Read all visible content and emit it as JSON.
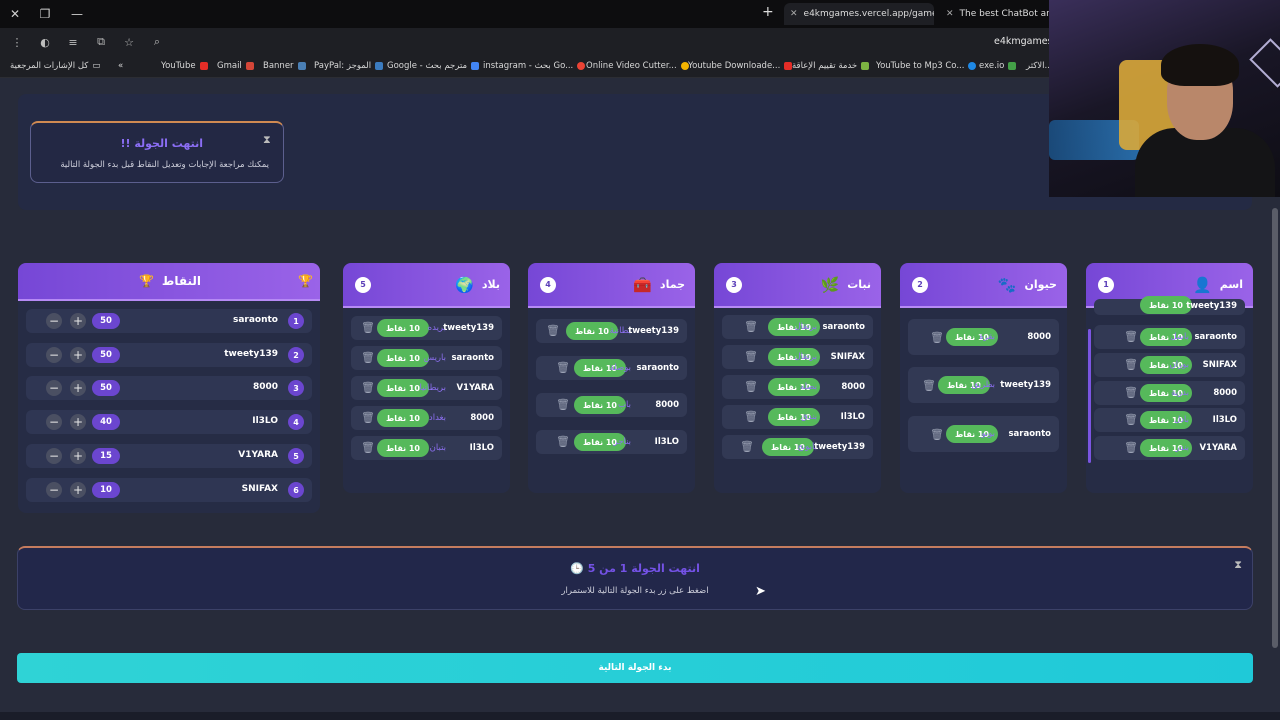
{
  "browser": {
    "tabs": [
      {
        "label": "e4kmgames.vercel.app/games/"
      },
      {
        "label": "The best ChatBot and Wi"
      }
    ],
    "url": "e4kmgames.v",
    "bookmarks": [
      {
        "label": "كل الإشارات المرجعية"
      },
      {
        "label": "YouTube"
      },
      {
        "label": "Gmail"
      },
      {
        "label": "Banner"
      },
      {
        "label": "PayPal: الموجز"
      },
      {
        "label": "Google - مترجم بحث"
      },
      {
        "label": "instagram - بحث Go..."
      },
      {
        "label": "Online Video Cutter..."
      },
      {
        "label": "Youtube Downloade..."
      },
      {
        "label": "خدمة تقييم الإعاقة"
      },
      {
        "label": "YouTube to Mp3 Co..."
      },
      {
        "label": "exe.io"
      },
      {
        "label": "الاكثر..."
      }
    ]
  },
  "notice": {
    "title": "انتهت الجولة !!",
    "subtitle": "يمكنك مراجعة الإجابات وتعديل النقاط قبل بدء الجولة التالية"
  },
  "scoreboard": {
    "title": "النقاط",
    "rows": [
      {
        "rank": "1",
        "name": "saraonto",
        "score": "50"
      },
      {
        "rank": "2",
        "name": "tweety139",
        "score": "50"
      },
      {
        "rank": "3",
        "name": "8000",
        "score": "50"
      },
      {
        "rank": "4",
        "name": "Il3LO",
        "score": "40"
      },
      {
        "rank": "5",
        "name": "V1YARA",
        "score": "15"
      },
      {
        "rank": "6",
        "name": "SNIFAX",
        "score": "10"
      }
    ]
  },
  "categories": [
    {
      "num": "1",
      "title": "اسم",
      "answers": [
        {
          "player": "tweety139",
          "word": "",
          "points": "10 نقاط"
        },
        {
          "player": "saraonto",
          "word": "باسل",
          "points": "10 نقاط"
        },
        {
          "player": "SNIFAX",
          "word": "بوران",
          "points": "10 نقاط"
        },
        {
          "player": "8000",
          "word": "بدرية",
          "points": "10 نقاط"
        },
        {
          "player": "Il3LO",
          "word": "بادل",
          "points": "10 نقاط"
        },
        {
          "player": "V1YARA",
          "word": "بندر",
          "points": "10 نقاط"
        }
      ]
    },
    {
      "num": "2",
      "title": "حيوان",
      "answers": [
        {
          "player": "8000",
          "word": "بقرة",
          "points": "10 نقاط"
        },
        {
          "player": "tweety139",
          "word": "بطريق",
          "points": "10 نقاط"
        },
        {
          "player": "saraonto",
          "word": "بوبو",
          "points": "10 نقاط"
        }
      ]
    },
    {
      "num": "3",
      "title": "نبات",
      "answers": [
        {
          "player": "saraonto",
          "word": "برتقال",
          "points": "10 نقاط"
        },
        {
          "player": "SNIFAX",
          "word": "برتقال",
          "points": "10 نقاط"
        },
        {
          "player": "8000",
          "word": "بصله",
          "points": "10 نقاط"
        },
        {
          "player": "Il3LO",
          "word": "بندق",
          "points": "10 نقاط"
        },
        {
          "player": "tweety139",
          "word": "بابونج",
          "points": "10 نقاط"
        }
      ]
    },
    {
      "num": "4",
      "title": "جماد",
      "answers": [
        {
          "player": "tweety139",
          "word": "بطانية",
          "points": "10 نقاط"
        },
        {
          "player": "saraonto",
          "word": "بوصلة",
          "points": "10 نقاط"
        },
        {
          "player": "8000",
          "word": "باب",
          "points": "10 نقاط"
        },
        {
          "player": "Il3LO",
          "word": "بناجر",
          "points": "10 نقاط"
        }
      ]
    },
    {
      "num": "5",
      "title": "بلاد",
      "answers": [
        {
          "player": "tweety139",
          "word": "بريده",
          "points": "10 نقاط"
        },
        {
          "player": "saraonto",
          "word": "باريس",
          "points": "10 نقاط"
        },
        {
          "player": "V1YARA",
          "word": "بريطانيا",
          "points": "10 نقاط"
        },
        {
          "player": "8000",
          "word": "بغداد",
          "points": "10 نقاط"
        },
        {
          "player": "Il3LO",
          "word": "بتبان",
          "points": "10 نقاط"
        }
      ]
    }
  ],
  "round_status": {
    "title": "انتهت الجولة 1 من 5",
    "subtitle": "اضغط على زر بدء الجولة التالية للاستمرار"
  },
  "next_round_button": "بدء الجولة التالية",
  "colors": {
    "accent": "#7a4fdc",
    "points": "#56b95b",
    "cta": "#22cdd7"
  }
}
